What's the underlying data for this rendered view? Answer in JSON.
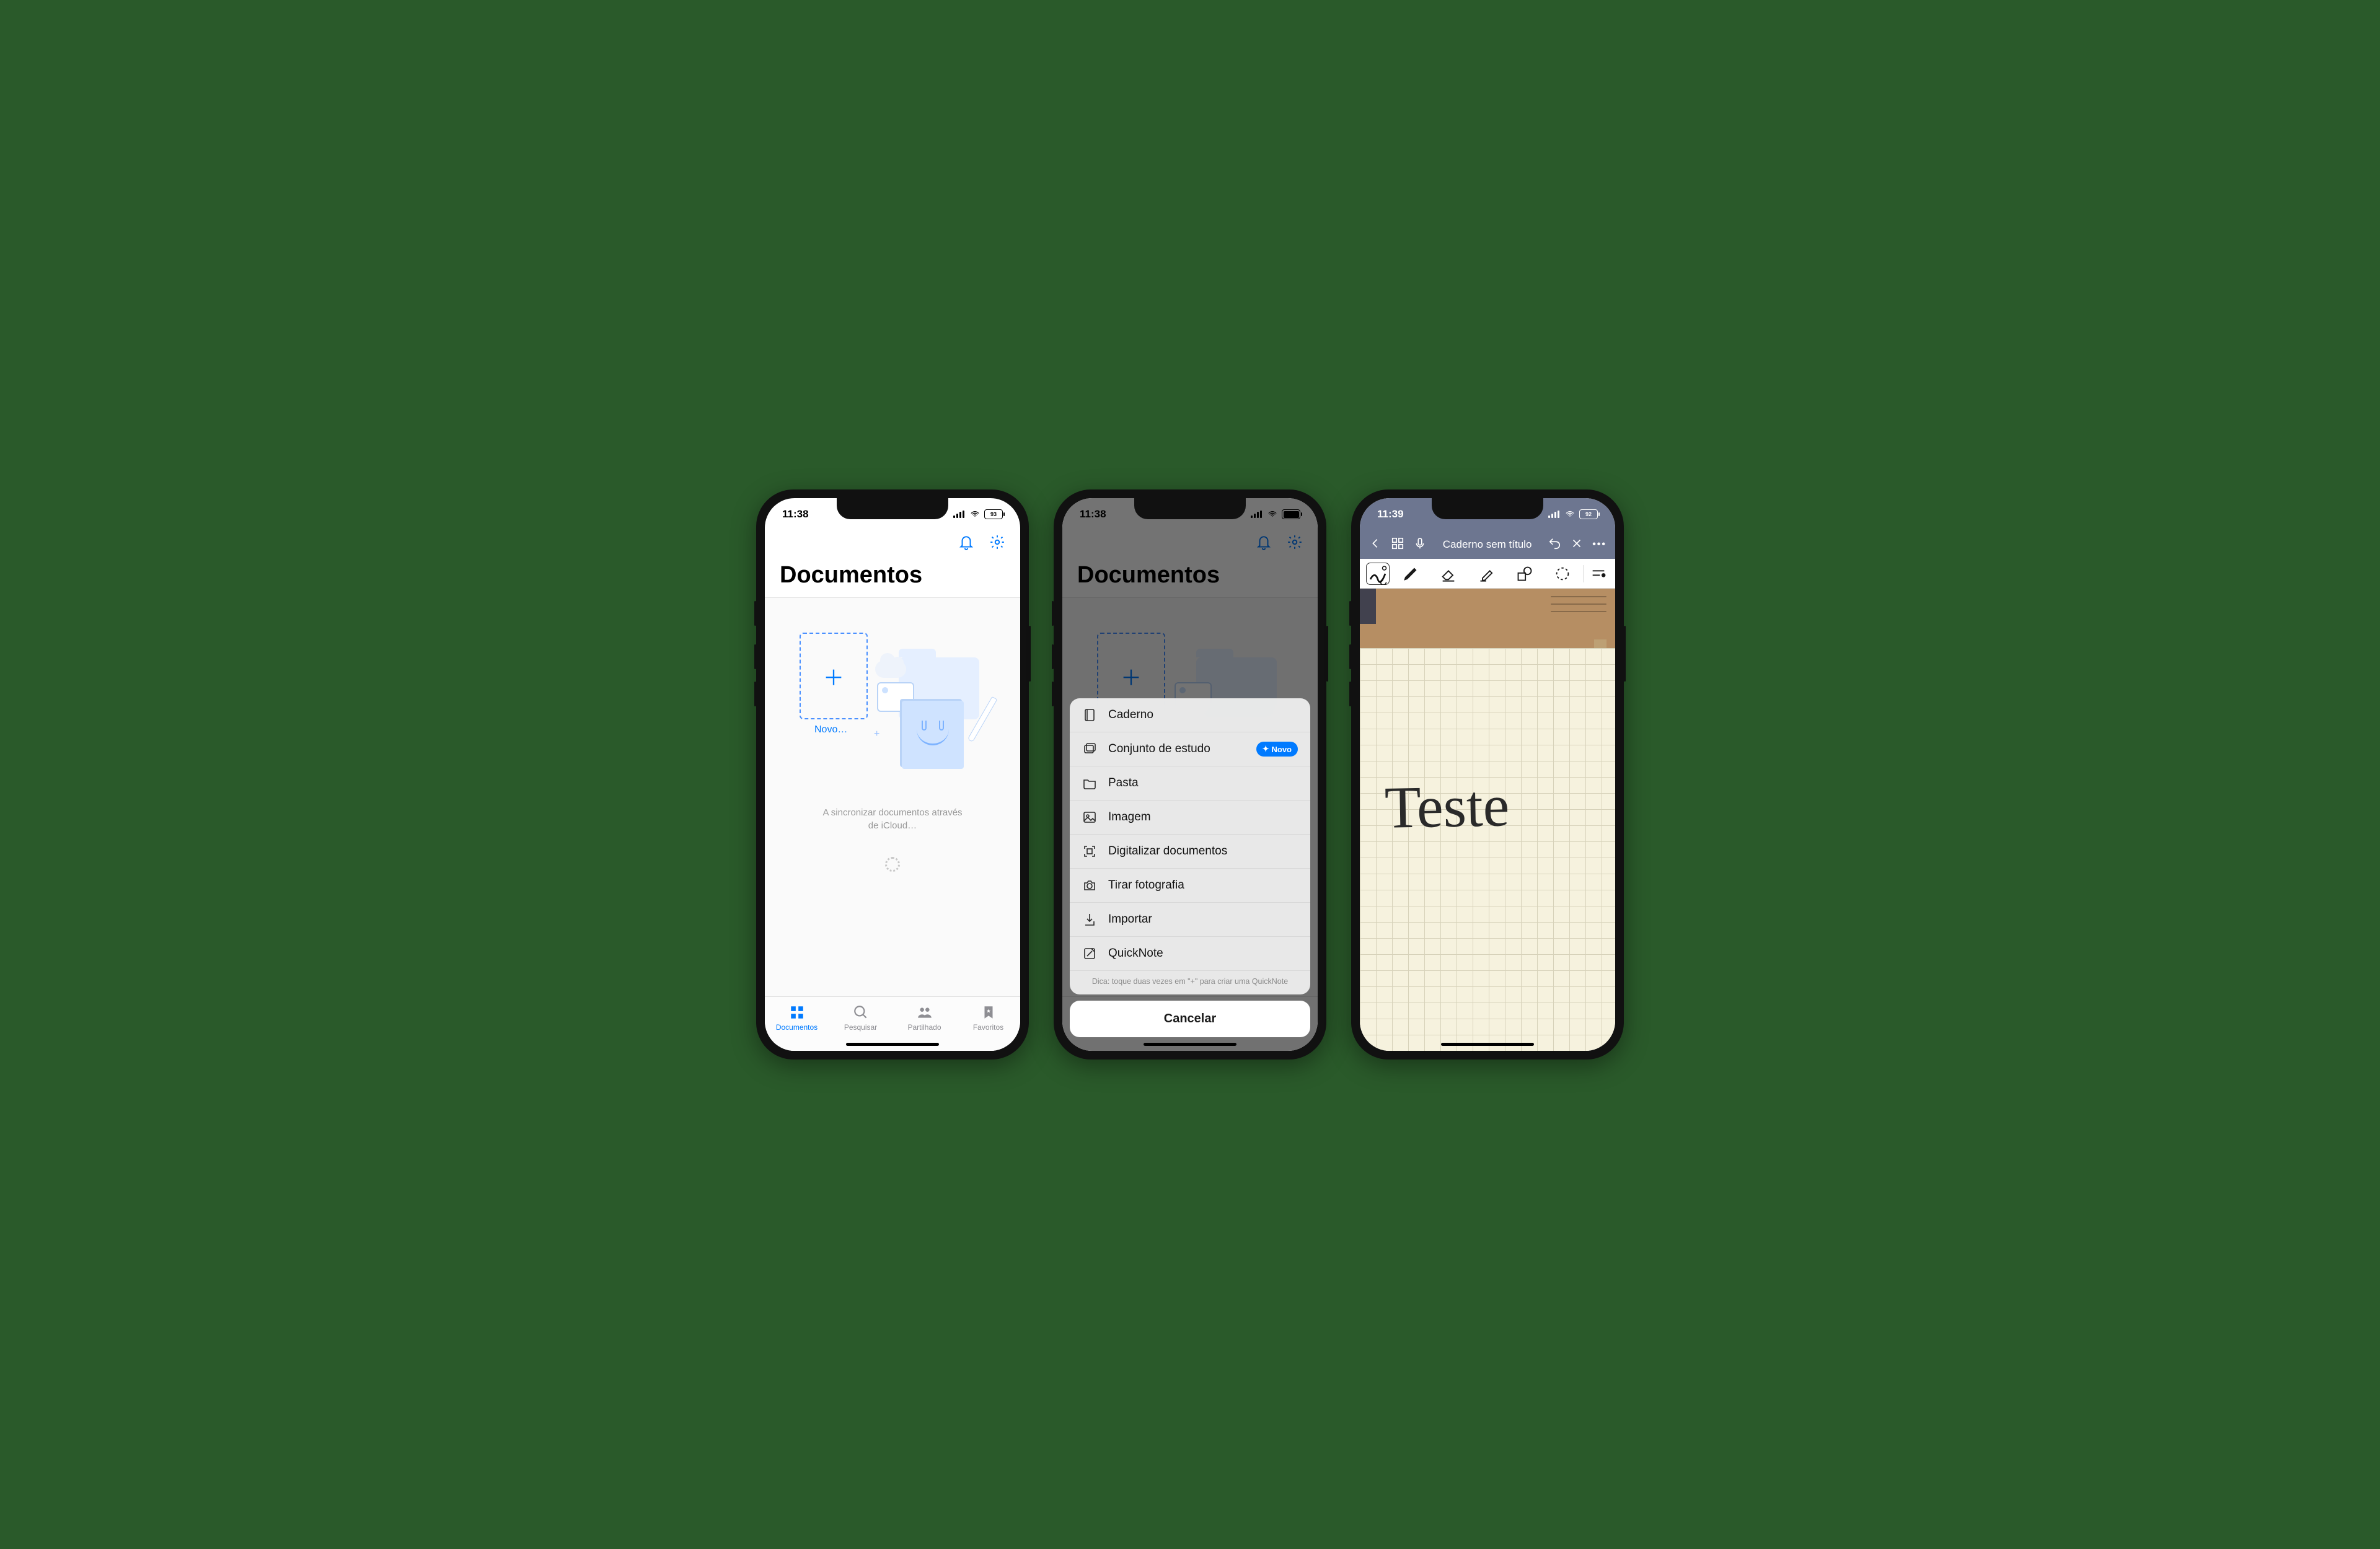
{
  "screen1": {
    "statusbar": {
      "time": "11:38",
      "battery": "93"
    },
    "title": "Documentos",
    "new_label": "Novo…",
    "sync_text": "A sincronizar documentos através\nde iCloud…",
    "tabs": [
      {
        "label": "Documentos"
      },
      {
        "label": "Pesquisar"
      },
      {
        "label": "Partilhado"
      },
      {
        "label": "Favoritos"
      }
    ]
  },
  "screen2": {
    "statusbar": {
      "time": "11:38",
      "battery": "93"
    },
    "title": "Documentos",
    "menu": [
      {
        "label": "Caderno"
      },
      {
        "label": "Conjunto de estudo",
        "badge": "Novo"
      },
      {
        "label": "Pasta"
      },
      {
        "label": "Imagem"
      },
      {
        "label": "Digitalizar documentos"
      },
      {
        "label": "Tirar fotografia"
      },
      {
        "label": "Importar"
      },
      {
        "label": "QuickNote"
      }
    ],
    "hint": "Dica: toque duas vezes em \"+\" para criar uma QuickNote",
    "cancel": "Cancelar"
  },
  "screen3": {
    "statusbar": {
      "time": "11:39",
      "battery": "92"
    },
    "nav_title": "Caderno sem título",
    "handwriting": "Teste"
  }
}
